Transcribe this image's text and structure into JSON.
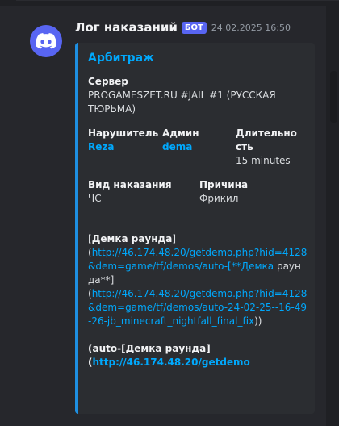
{
  "message": {
    "author": "Лог наказаний",
    "bot_tag": "БОТ",
    "timestamp": "24.02.2025 16:50"
  },
  "embed": {
    "accent_color": "#1e8fe1",
    "title": "Арбитраж",
    "server": {
      "name": "Сервер",
      "value": "PROGAMESZET.RU #JAIL #1 (РУССКАЯ ТЮРЬМА)"
    },
    "violator": {
      "name": "Нарушитель",
      "value": "Reza"
    },
    "admin": {
      "name": "Админ",
      "value": "dema"
    },
    "duration": {
      "name": "Длительность",
      "value": "15 minutes"
    },
    "punishment_type": {
      "name": "Вид наказания",
      "value": "ЧС"
    },
    "reason": {
      "name": "Причина",
      "value": "Фрикил"
    },
    "description": {
      "p1_open": "[",
      "p1_bold": "Демка раунда",
      "p1_close": "]",
      "p2_open": "(",
      "p2_link": "http://46.174.48.20/getdemo.php?hid=4128&dem=game/tf/demos/auto-[**Демка",
      "p2_rest": " раунда**]",
      "p3_open": "(",
      "p3_link": "http://46.174.48.20/getdemo.php?hid=4128&dem=game/tf/demos/auto-24-02-25--16-49-26-jb_minecraft_nightfall_final_fix",
      "p3_close": "))",
      "p4_pre": "(auto-[",
      "p4_bold": "Демка раунда",
      "p4_post": "]",
      "p5_open": "(",
      "p5_link": "http://46.174.48.20/getdemo"
    }
  },
  "colors": {
    "background": "#1f2024",
    "message_bg": "#26272c",
    "embed_bg": "#2b2d31",
    "link": "#00a8fc",
    "blurple": "#5865f2"
  },
  "icons": {
    "avatar": "discord-logo-icon"
  }
}
